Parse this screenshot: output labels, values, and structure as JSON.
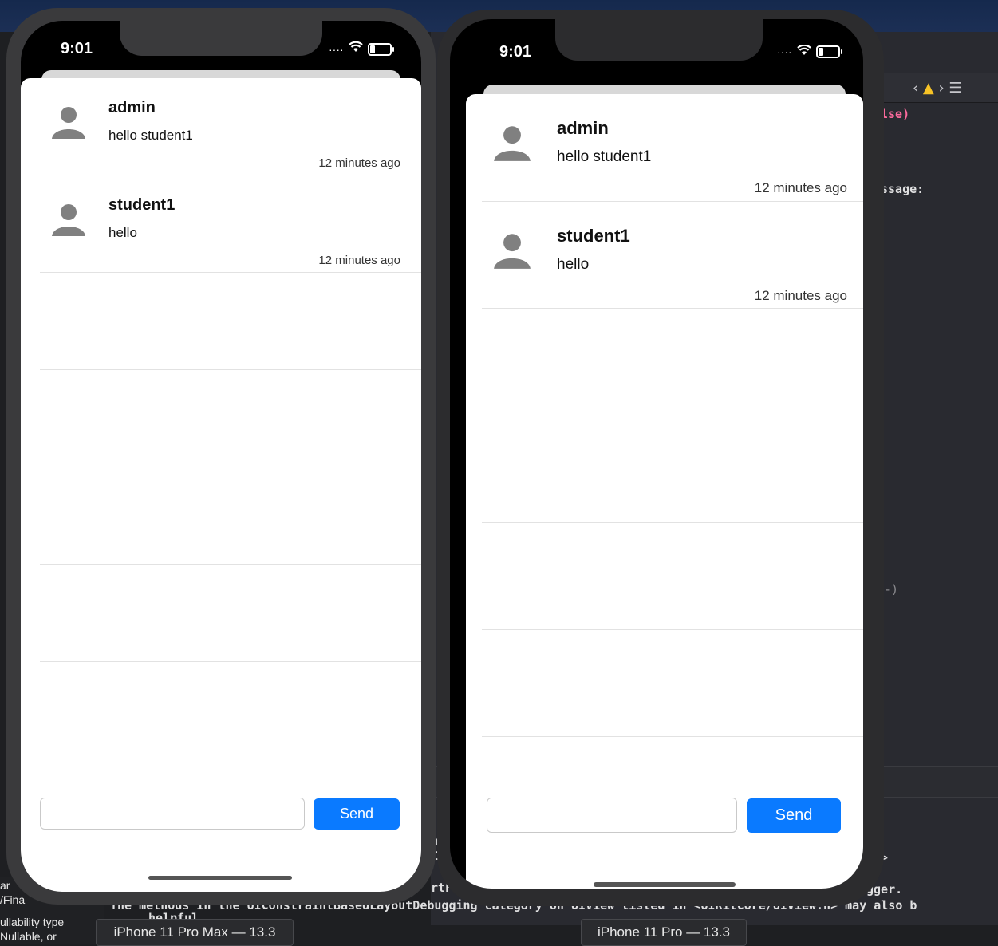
{
  "background": {
    "code_fragments": [
      "lse)",
      "ssage:",
      "-)",
      "gger.",
      "helpful"
    ],
    "console_line": "The methods in the UIConstraintBasedLayoutDebugging category on UIView listed in <UIKitCore/UIView.h> may also b",
    "console_frag_1": "rtFor",
    "console_frag_2": "r",
    "console_frag_3": "1",
    "gt_sign": ">",
    "left_texts": [
      "ar",
      "/Fina",
      "ullability type",
      "Nullable, or"
    ]
  },
  "simulators": [
    {
      "label": "iPhone 11 Pro Max — 13.3",
      "status_time": "9:01",
      "messages": [
        {
          "sender": "admin",
          "text": "hello student1",
          "time": "12 minutes ago"
        },
        {
          "sender": "student1",
          "text": "hello",
          "time": "12 minutes ago"
        }
      ],
      "input_value": "",
      "send_label": "Send"
    },
    {
      "label": "iPhone 11 Pro — 13.3",
      "status_time": "9:01",
      "messages": [
        {
          "sender": "admin",
          "text": "hello student1",
          "time": "12 minutes ago"
        },
        {
          "sender": "student1",
          "text": "hello",
          "time": "12 minutes ago"
        }
      ],
      "input_value": "",
      "send_label": "Send"
    }
  ],
  "colors": {
    "accent": "#0a7aff",
    "warning": "#f7c326"
  }
}
